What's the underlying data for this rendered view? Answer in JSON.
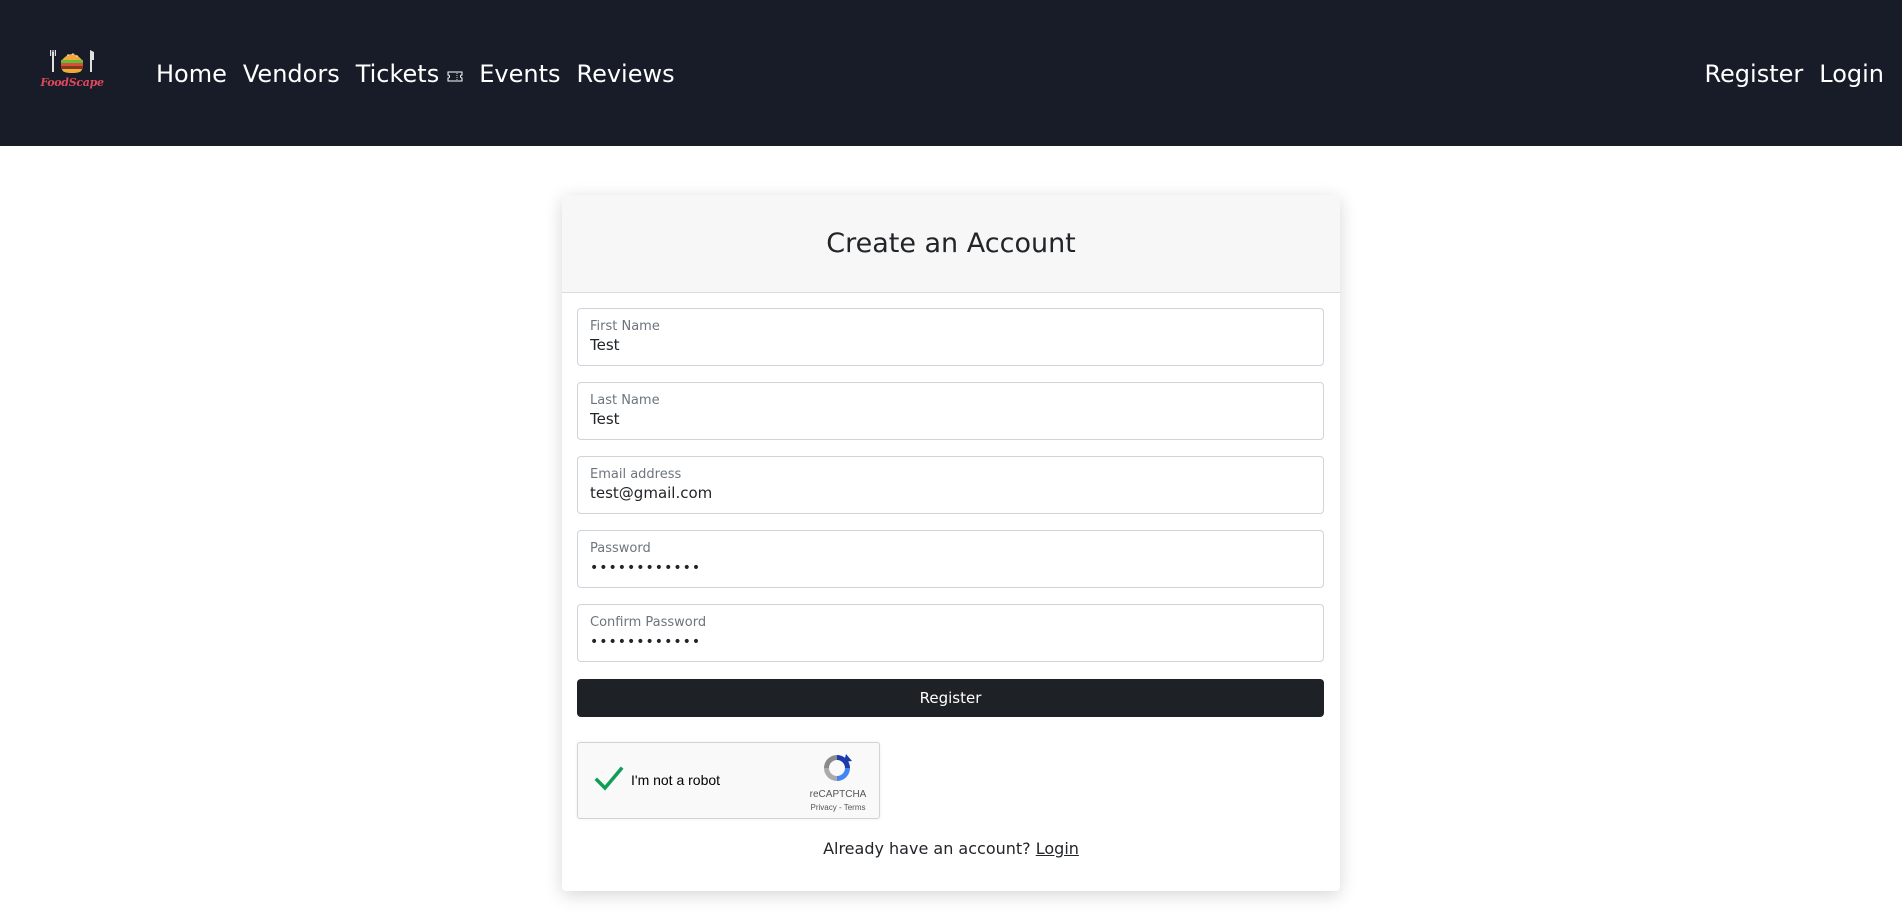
{
  "brand": {
    "logo_text": "FoodScape",
    "accent_color": "#e0475c"
  },
  "nav": {
    "left": [
      "Home",
      "Vendors",
      "Tickets",
      "Events",
      "Reviews"
    ],
    "right": [
      "Register",
      "Login"
    ],
    "background": "#171c28"
  },
  "form": {
    "title": "Create an Account",
    "fields": [
      {
        "label": "First Name",
        "value": "Test"
      },
      {
        "label": "Last Name",
        "value": "Test"
      },
      {
        "label": "Email address",
        "value": "test@gmail.com"
      },
      {
        "label": "Password",
        "value": "••••••••••••"
      },
      {
        "label": "Confirm Password",
        "value": "••••••••••••"
      }
    ],
    "submit_label": "Register",
    "button_color": "#1e2125"
  },
  "captcha": {
    "label": "I'm not a robot",
    "brand": "reCAPTCHA",
    "links": "Privacy - Terms",
    "checked": true,
    "check_icon": "checkmark-icon"
  },
  "footer_prompt": {
    "text": "Already have an account?",
    "link": "Login"
  }
}
